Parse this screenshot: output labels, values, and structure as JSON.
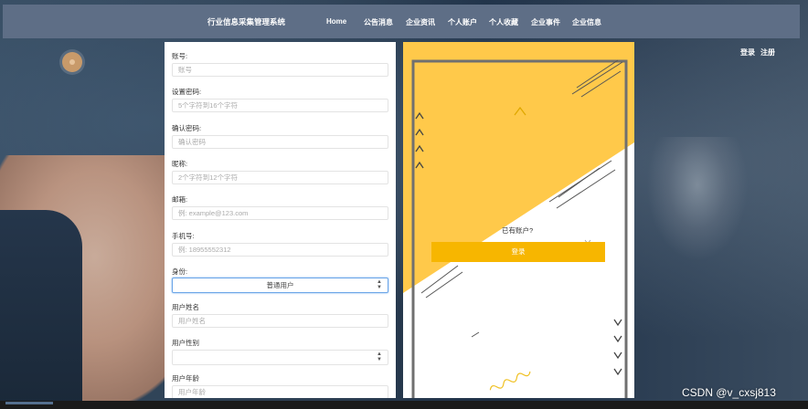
{
  "navbar": {
    "brand": "行业信息采集管理系统",
    "items": [
      "Home",
      "公告消息",
      "企业资讯",
      "个人账户",
      "个人收藏",
      "企业事件",
      "企业信息"
    ]
  },
  "auth": {
    "login": "登录",
    "register": "注册"
  },
  "form": {
    "fields": [
      {
        "label": "账号:",
        "placeholder": "账号"
      },
      {
        "label": "设置密码:",
        "placeholder": "5个字符到16个字符"
      },
      {
        "label": "确认密码:",
        "placeholder": "确认密码"
      },
      {
        "label": "昵称:",
        "placeholder": "2个字符到12个字符"
      },
      {
        "label": "邮箱:",
        "placeholder": "例: example@123.com"
      },
      {
        "label": "手机号:",
        "placeholder": "例: 18955552312"
      }
    ],
    "identity": {
      "label": "身份:",
      "value": "普通用户"
    },
    "user_name": {
      "label": "用户姓名",
      "placeholder": "用户姓名"
    },
    "user_gender": {
      "label": "用户性别",
      "value": ""
    },
    "user_age": {
      "label": "用户年龄",
      "placeholder": "用户年龄"
    }
  },
  "side": {
    "have_account": "已有账户?",
    "login_button": "登录"
  },
  "colors": {
    "accent": "#f7b600",
    "deco_yellow": "#ffc94a",
    "navbar": "#5e6e86"
  },
  "watermark": "CSDN @v_cxsj813"
}
